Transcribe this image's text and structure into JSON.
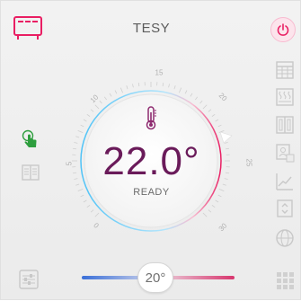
{
  "header": {
    "title": "TESY"
  },
  "thermostat": {
    "temperature": "22.0°",
    "status": "READY",
    "scale_labels": [
      "0",
      "5",
      "10",
      "15",
      "20",
      "25",
      "30"
    ]
  },
  "slider": {
    "setpoint": "20°"
  },
  "icons": {
    "heater": "heater-panel-icon",
    "power": "power-icon",
    "touch": "touch-hand-icon",
    "manual": "book-icon",
    "settings": "sliders-icon",
    "calendar": "calendar-icon",
    "radiator": "radiator-icon",
    "window": "window-icon",
    "presence": "presence-icon",
    "chart": "chart-icon",
    "boost": "boost-icon",
    "globe": "globe-icon",
    "apps": "apps-grid-icon"
  },
  "colors": {
    "accent": "#e91e63",
    "temp_text": "#6a1b5a",
    "active_green": "#2e9e3e",
    "icon_gray": "#c8c8c8"
  }
}
